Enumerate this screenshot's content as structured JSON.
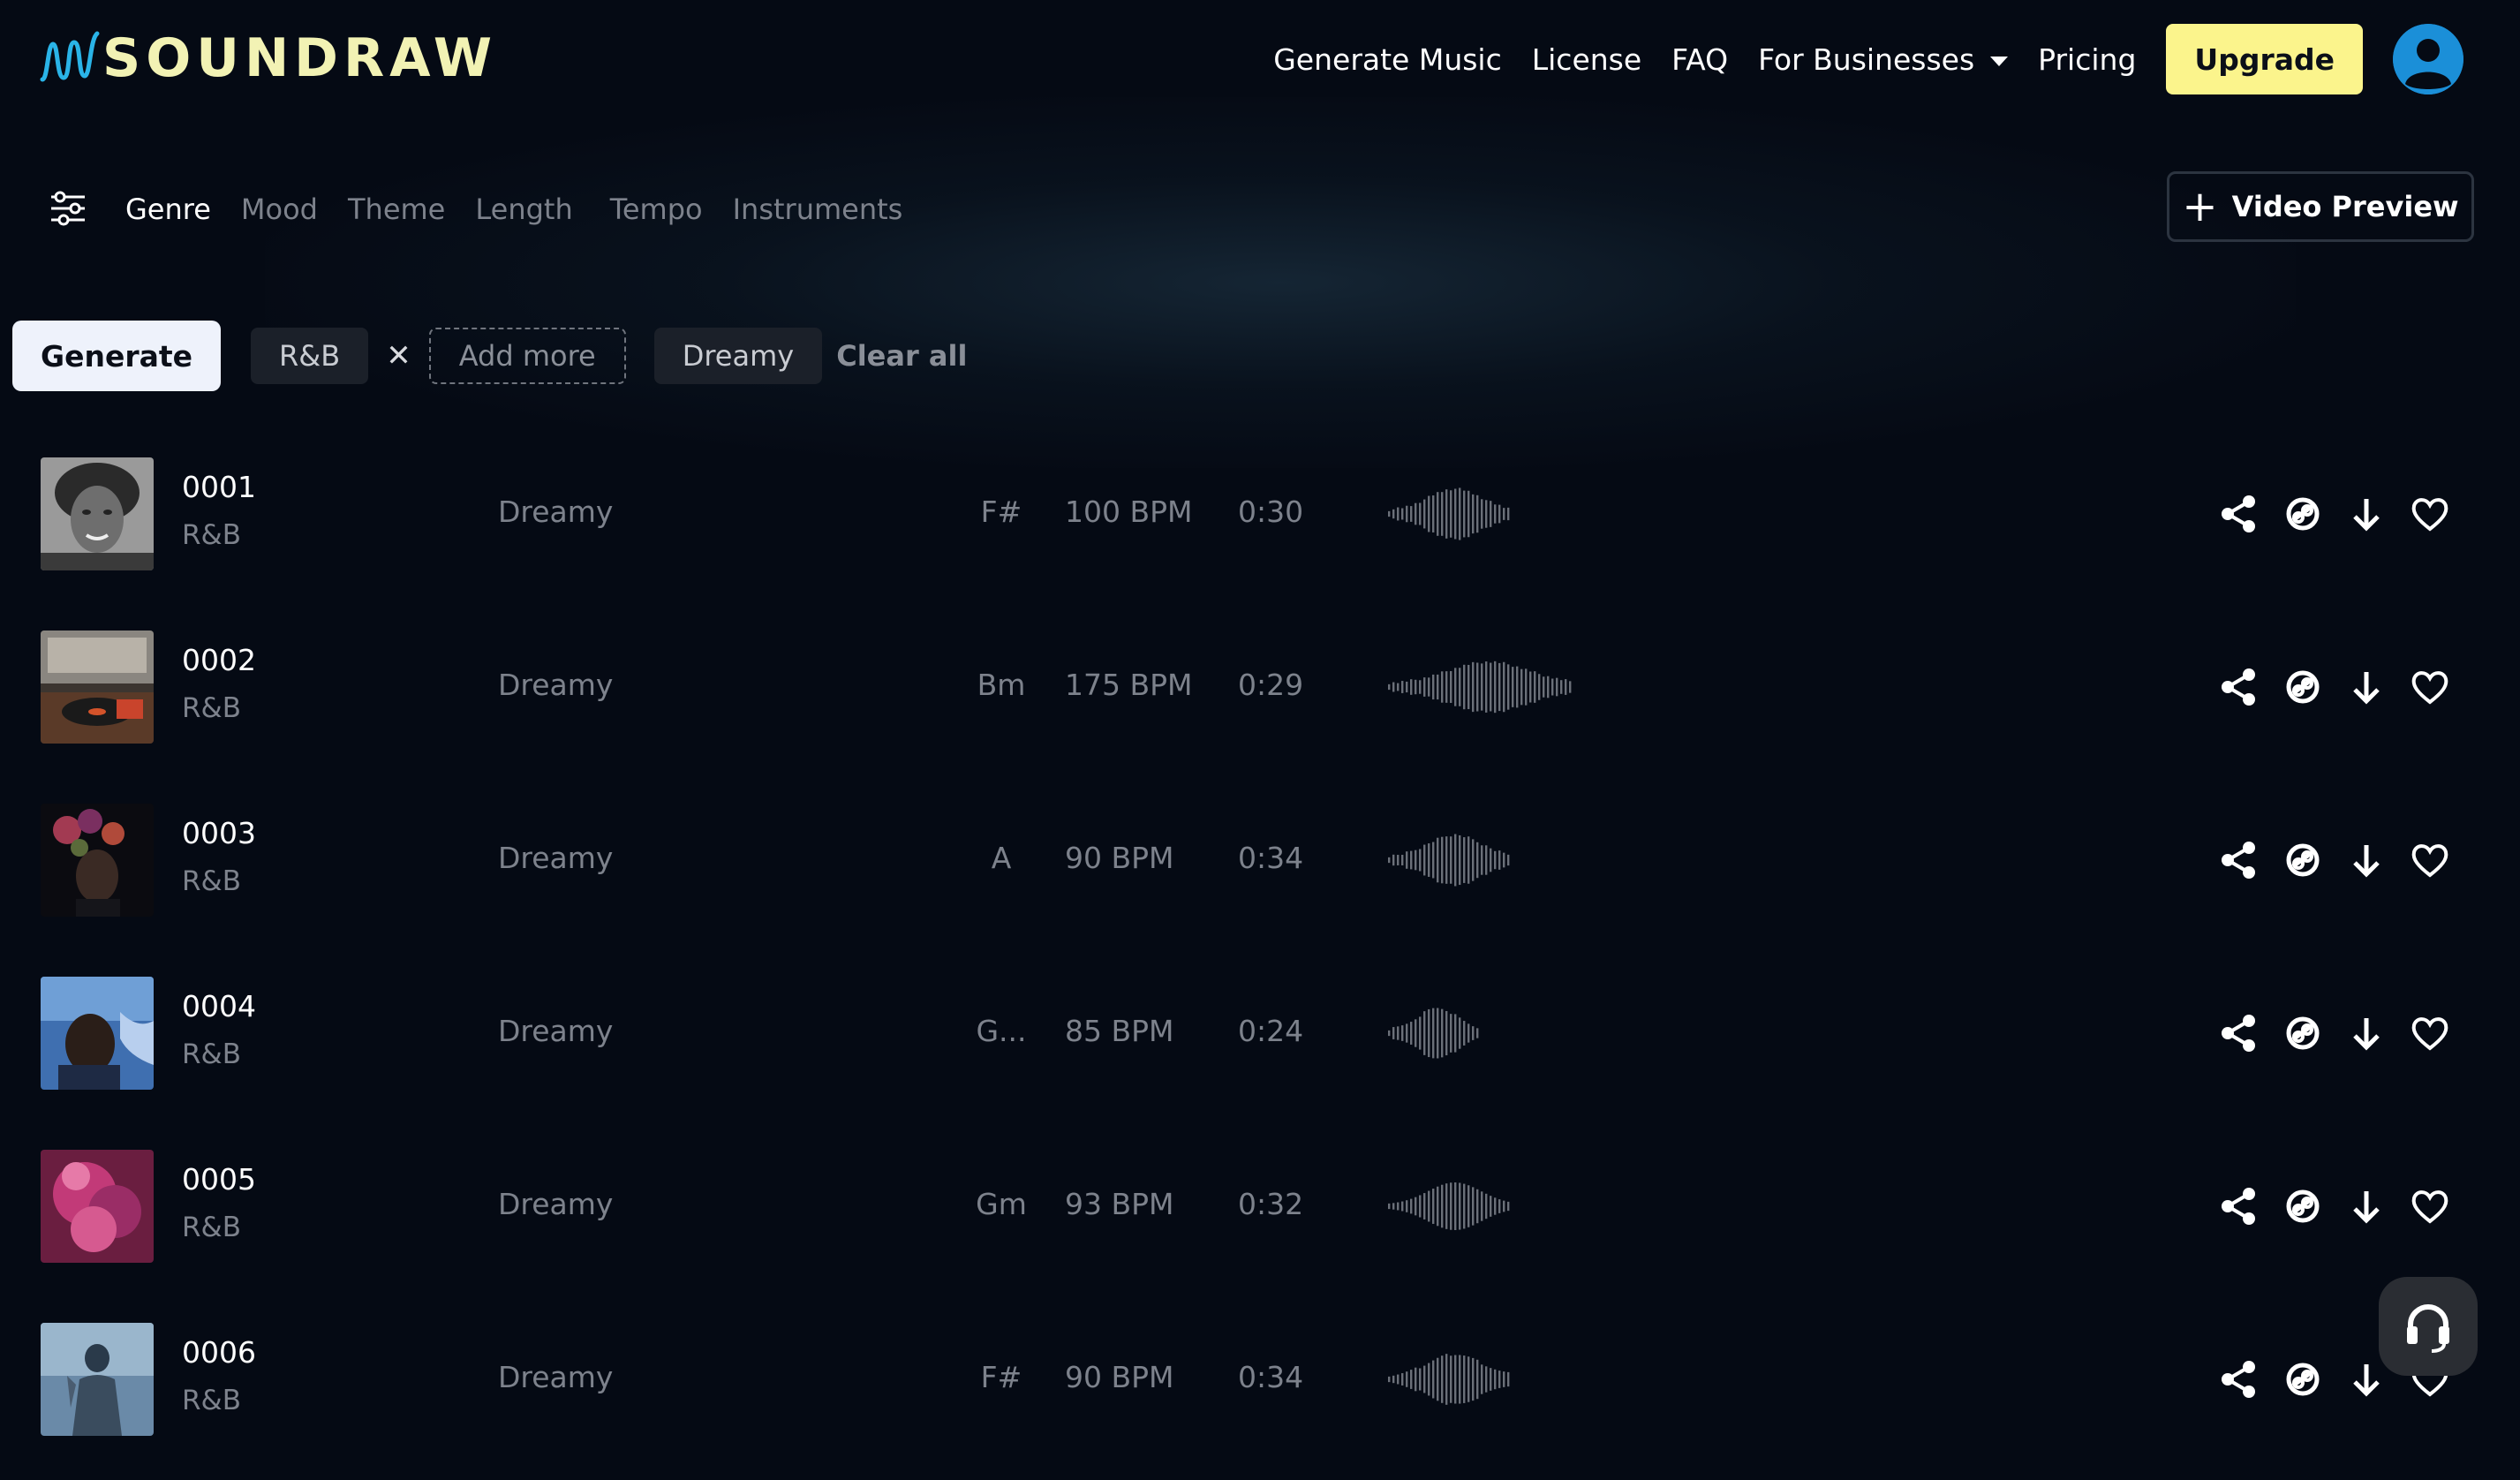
{
  "brand": {
    "name": "SOUNDRAW",
    "color": "#f2f2b4"
  },
  "nav": {
    "items": [
      "Generate Music",
      "License",
      "FAQ",
      "For Businesses",
      "Pricing"
    ],
    "upgrade_label": "Upgrade",
    "upgrade_color": "#fbf48c",
    "avatar_color": "#1b8fd8"
  },
  "filters": {
    "tabs": [
      "Genre",
      "Mood",
      "Theme",
      "Length",
      "Tempo",
      "Instruments"
    ],
    "active_tab": "Genre",
    "video_preview_label": "Video Preview"
  },
  "chips": {
    "generate_label": "Generate",
    "selected": [
      "R&B",
      "Dreamy"
    ],
    "add_more_label": "Add more",
    "clear_all_label": "Clear all"
  },
  "tracks": [
    {
      "num": "0001",
      "genre": "R&B",
      "mood": "Dreamy",
      "key": "F#",
      "bpm": "100 BPM",
      "length": "0:30",
      "thumb": "portrait-woman"
    },
    {
      "num": "0002",
      "genre": "R&B",
      "mood": "Dreamy",
      "key": "Bm",
      "bpm": "175 BPM",
      "length": "0:29",
      "thumb": "record-player"
    },
    {
      "num": "0003",
      "genre": "R&B",
      "mood": "Dreamy",
      "key": "A",
      "bpm": "90 BPM",
      "length": "0:34",
      "thumb": "flowers-portrait"
    },
    {
      "num": "0004",
      "genre": "R&B",
      "mood": "Dreamy",
      "key": "G...",
      "bpm": "85 BPM",
      "length": "0:24",
      "thumb": "blue-portrait"
    },
    {
      "num": "0005",
      "genre": "R&B",
      "mood": "Dreamy",
      "key": "Gm",
      "bpm": "93 BPM",
      "length": "0:32",
      "thumb": "pink-smoke"
    },
    {
      "num": "0006",
      "genre": "R&B",
      "mood": "Dreamy",
      "key": "F#",
      "bpm": "90 BPM",
      "length": "0:34",
      "thumb": "statue"
    }
  ],
  "icons": {
    "filter": "sliders-icon",
    "share": "share-icon",
    "link": "link-icon",
    "download": "download-icon",
    "favorite": "heart-icon",
    "support": "headset-icon"
  }
}
